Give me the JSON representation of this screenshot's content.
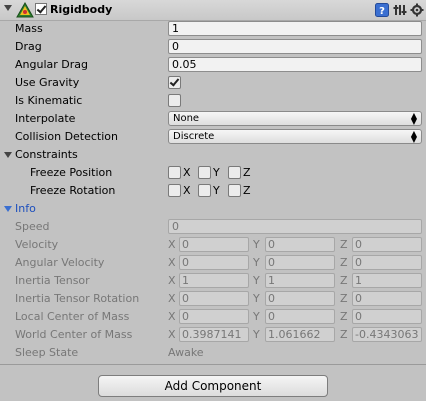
{
  "component": {
    "title": "Rigidbody",
    "icons": [
      "rigidbody-icon",
      "help-icon",
      "preset-icon",
      "settings-gear-icon"
    ]
  },
  "fields": {
    "mass": {
      "label": "Mass",
      "value": "1"
    },
    "drag": {
      "label": "Drag",
      "value": "0"
    },
    "angular_drag": {
      "label": "Angular Drag",
      "value": "0.05"
    },
    "use_gravity": {
      "label": "Use Gravity",
      "checked": true
    },
    "is_kinematic": {
      "label": "Is Kinematic",
      "checked": false
    },
    "interpolate": {
      "label": "Interpolate",
      "value": "None"
    },
    "collision_detection": {
      "label": "Collision Detection",
      "value": "Discrete"
    }
  },
  "constraints": {
    "label": "Constraints",
    "freeze_position": {
      "label": "Freeze Position",
      "x": "X",
      "y": "Y",
      "z": "Z"
    },
    "freeze_rotation": {
      "label": "Freeze Rotation",
      "x": "X",
      "y": "Y",
      "z": "Z"
    }
  },
  "info": {
    "label": "Info",
    "speed": {
      "label": "Speed",
      "value": "0"
    },
    "velocity": {
      "label": "Velocity",
      "x": "0",
      "y": "0",
      "z": "0"
    },
    "angular_velocity": {
      "label": "Angular Velocity",
      "x": "0",
      "y": "0",
      "z": "0"
    },
    "inertia_tensor": {
      "label": "Inertia Tensor",
      "x": "1",
      "y": "1",
      "z": "1"
    },
    "inertia_tensor_rotation": {
      "label": "Inertia Tensor Rotation",
      "x": "0",
      "y": "0",
      "z": "0"
    },
    "local_center_of_mass": {
      "label": "Local Center of Mass",
      "x": "0",
      "y": "0",
      "z": "0"
    },
    "world_center_of_mass": {
      "label": "World Center of Mass",
      "x": "0.3987141",
      "y": "1.061662",
      "z": "-0.4343063"
    },
    "sleep_state": {
      "label": "Sleep State",
      "value": "Awake"
    },
    "axis_labels": {
      "x": "X",
      "y": "Y",
      "z": "Z"
    }
  },
  "add_component": {
    "label": "Add Component"
  },
  "colors": {
    "background": "#c2c2c2",
    "info_label": "#1d4fbd",
    "disabled_text": "#777777"
  }
}
